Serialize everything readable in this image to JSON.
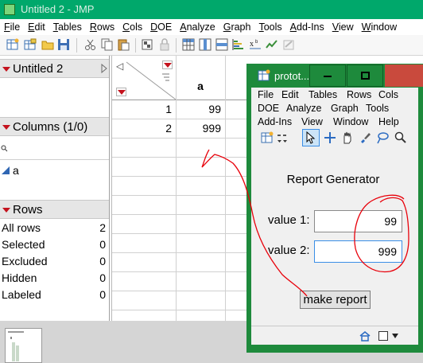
{
  "window": {
    "title": "Untitled 2 - JMP"
  },
  "menubar": {
    "items": [
      {
        "mnemonic": "F",
        "rest": "ile"
      },
      {
        "mnemonic": "E",
        "rest": "dit"
      },
      {
        "mnemonic": "T",
        "rest": "ables"
      },
      {
        "mnemonic": "R",
        "rest": "ows"
      },
      {
        "mnemonic": "C",
        "rest": "ols"
      },
      {
        "mnemonic": "D",
        "rest": "OE"
      },
      {
        "mnemonic": "A",
        "rest": "nalyze"
      },
      {
        "mnemonic": "G",
        "rest": "raph"
      },
      {
        "mnemonic": "T",
        "rest": "ools"
      },
      {
        "mnemonic": "A",
        "rest": "dd-Ins"
      },
      {
        "mnemonic": "V",
        "rest": "iew"
      },
      {
        "mnemonic": "W",
        "rest": "indow"
      }
    ]
  },
  "toolbar": {
    "icons": [
      "new-data-table-icon",
      "open-data-table-icon",
      "open-folder-icon",
      "save-icon",
      "cut-icon",
      "copy-icon",
      "paste-icon",
      "paste-format-icon",
      "lock-icon",
      "data-table-icon",
      "columns-icon",
      "rows-icon",
      "distribution-icon",
      "formula-icon",
      "graph-builder-icon",
      "script-icon"
    ]
  },
  "left_panel": {
    "table_name": "Untitled 2",
    "columns_header": "Columns (1/0)",
    "column_search_icon": "search-icon",
    "columns": [
      {
        "name": "a",
        "icon": "continuous-column-icon"
      }
    ],
    "rows_header": "Rows",
    "row_stats": [
      {
        "label": "All rows",
        "value": "2"
      },
      {
        "label": "Selected",
        "value": "0"
      },
      {
        "label": "Excluded",
        "value": "0"
      },
      {
        "label": "Hidden",
        "value": "0"
      },
      {
        "label": "Labeled",
        "value": "0"
      }
    ]
  },
  "grid": {
    "column_header": "a",
    "row_numbers": [
      "1",
      "2"
    ],
    "values": [
      "99",
      "999"
    ]
  },
  "popup": {
    "title": "protot...",
    "menu_row1": [
      "File",
      "Edit",
      "Tables",
      "Rows",
      "Cols"
    ],
    "menu_row2": [
      "DOE",
      "Analyze",
      "Graph",
      "Tools"
    ],
    "menu_row3": [
      "Add-Ins",
      "View",
      "Window",
      "Help"
    ],
    "report_title": "Report Generator",
    "value1_label": "value 1:",
    "value1": "99",
    "value2_label": "value 2:",
    "value2": "999",
    "button_label": "make report",
    "colors": {
      "frame": "#1e8a3c",
      "close": "#c94a3d"
    }
  },
  "annotation": {
    "color": "#e8000a"
  },
  "colors": {
    "titlebar": "#00a86b",
    "disclosure": "#c4121d"
  }
}
